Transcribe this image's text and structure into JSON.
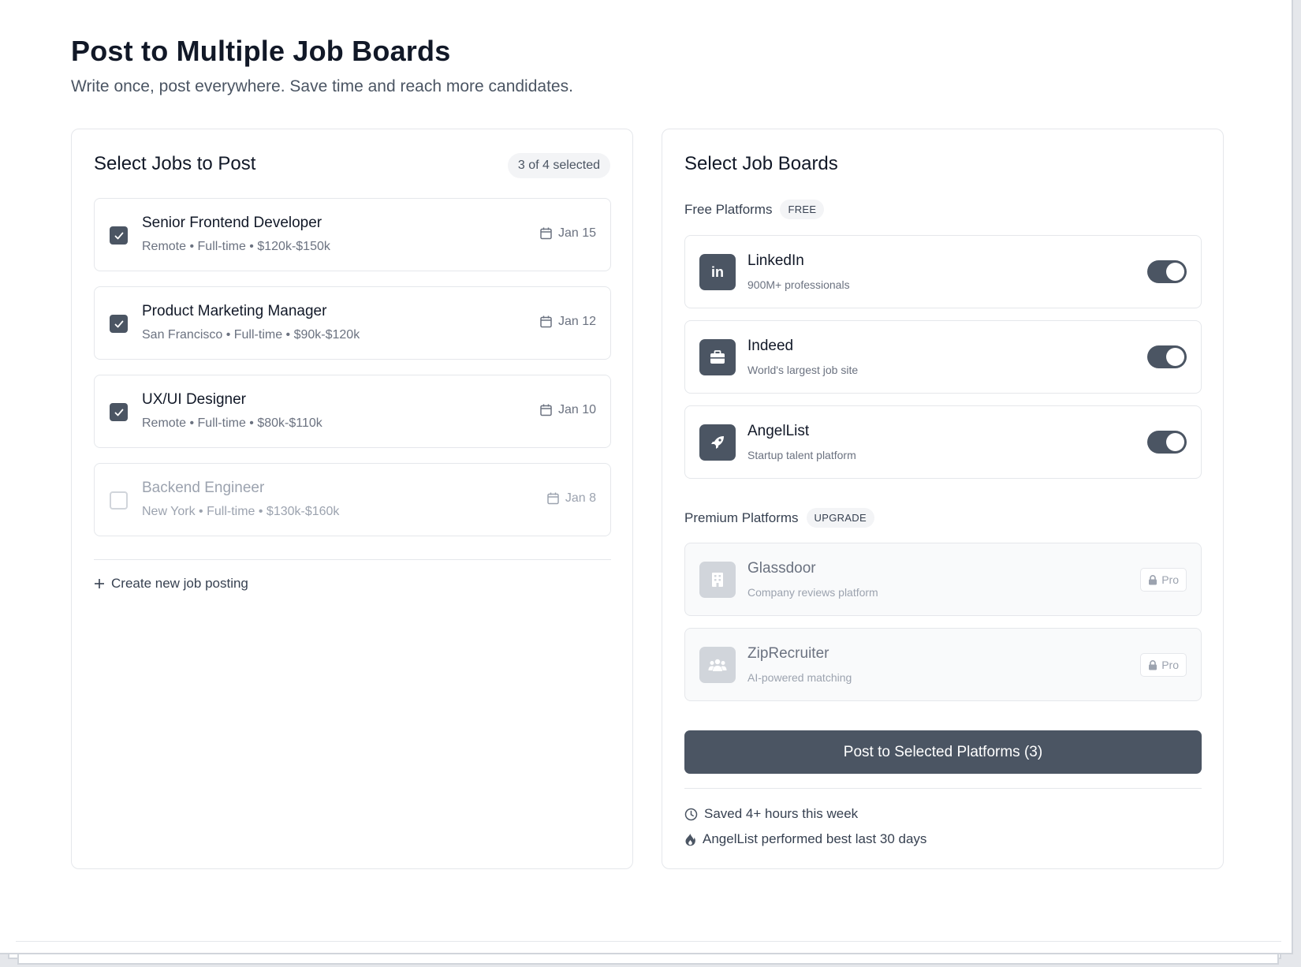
{
  "header": {
    "title": "Post to Multiple Job Boards",
    "subtitle": "Write once, post everywhere. Save time and reach more candidates."
  },
  "jobs_panel": {
    "title": "Select Jobs to Post",
    "selected_count": "3 of 4 selected",
    "jobs": [
      {
        "title": "Senior Frontend Developer",
        "meta": "Remote • Full-time • $120k-$150k",
        "date": "Jan 15",
        "checked": true
      },
      {
        "title": "Product Marketing Manager",
        "meta": "San Francisco • Full-time • $90k-$120k",
        "date": "Jan 12",
        "checked": true
      },
      {
        "title": "UX/UI Designer",
        "meta": "Remote • Full-time • $80k-$110k",
        "date": "Jan 10",
        "checked": true
      },
      {
        "title": "Backend Engineer",
        "meta": "New York • Full-time • $130k-$160k",
        "date": "Jan 8",
        "checked": false
      }
    ],
    "create_link": "Create new job posting"
  },
  "boards_panel": {
    "title": "Select Job Boards",
    "free_label": "Free Platforms",
    "free_badge": "FREE",
    "free_boards": [
      {
        "name": "LinkedIn",
        "desc": "900M+ professionals",
        "icon": "linkedin-icon",
        "enabled": true
      },
      {
        "name": "Indeed",
        "desc": "World's largest job site",
        "icon": "briefcase-icon",
        "enabled": true
      },
      {
        "name": "AngelList",
        "desc": "Startup talent platform",
        "icon": "rocket-icon",
        "enabled": true
      }
    ],
    "premium_label": "Premium Platforms",
    "premium_badge": "UPGRADE",
    "premium_boards": [
      {
        "name": "Glassdoor",
        "desc": "Company reviews platform",
        "icon": "building-icon",
        "tag": "Pro"
      },
      {
        "name": "ZipRecruiter",
        "desc": "AI-powered matching",
        "icon": "users-icon",
        "tag": "Pro"
      }
    ],
    "post_button": "Post to Selected Platforms (3)",
    "stats": [
      {
        "icon": "clock-icon",
        "text": "Saved 4+ hours this week"
      },
      {
        "icon": "fire-icon",
        "text": "AngelList performed best last 30 days"
      }
    ]
  },
  "colors": {
    "accent": "#4b5563",
    "border": "#e5e7eb",
    "text": "#111827",
    "muted": "#6b7280"
  }
}
